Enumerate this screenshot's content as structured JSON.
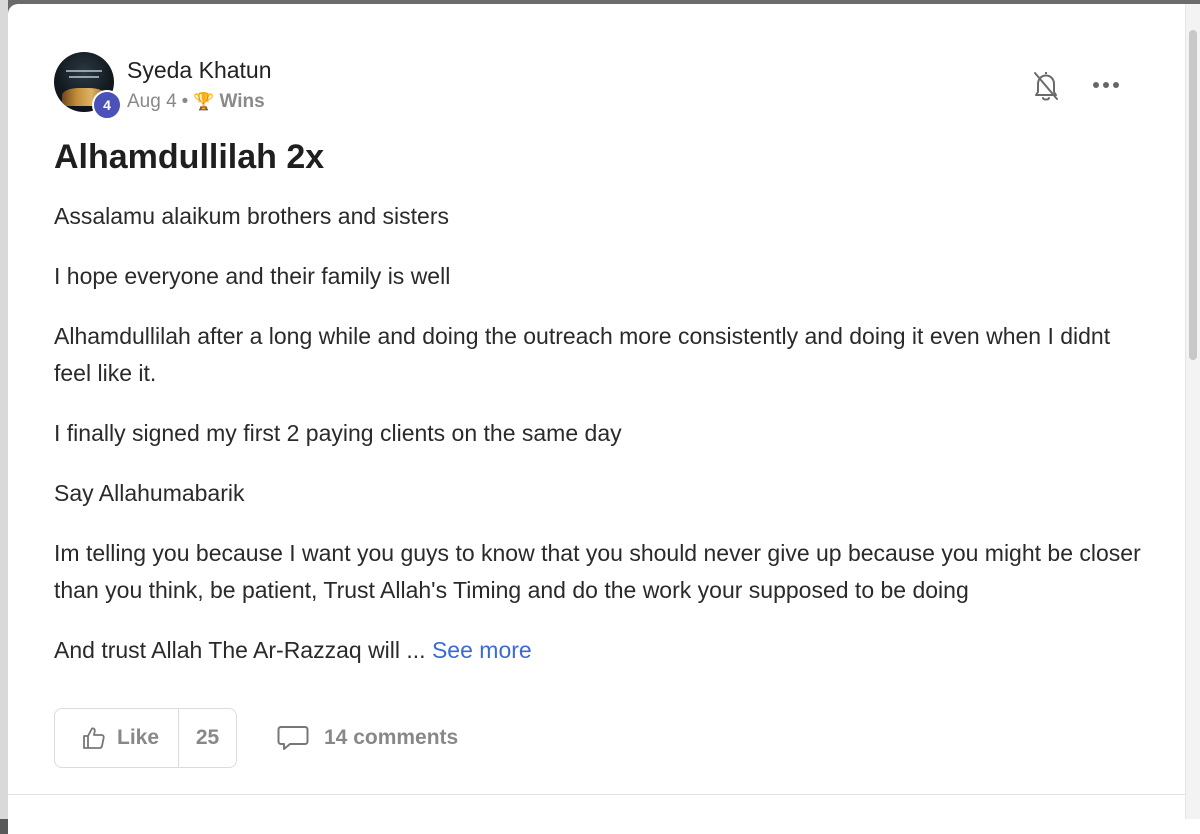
{
  "post": {
    "author": "Syeda Khatun",
    "level": "4",
    "date": "Aug 4",
    "separator": "•",
    "category": "Wins",
    "title": "Alhamdullilah 2x",
    "paragraphs": [
      "Assalamu alaikum brothers and sisters",
      "I hope everyone and their family is well",
      "Alhamdullilah after a long while and doing the outreach more consistently and doing it even when I didnt feel like it.",
      "I finally signed my first 2 paying clients on the same day",
      "Say Allahumabarik",
      "Im telling you because I want you guys to know that you should never give up because you might be closer than you think, be patient, Trust Allah's Timing and do the work your supposed to be doing"
    ],
    "truncated_text": "And trust Allah The Ar-Razzaq will ... ",
    "see_more": "See more"
  },
  "actions": {
    "like_label": "Like",
    "like_count": "25",
    "comments_label": "14 comments"
  },
  "icons": {
    "bell": "bell-off-icon",
    "more": "more-horizontal-icon",
    "like": "thumbs-up-icon",
    "comment": "comment-bubble-icon",
    "trophy": "trophy-icon"
  },
  "colors": {
    "accent_link": "#3b6ad6",
    "level_badge": "#4a52b8",
    "muted_text": "#888888"
  }
}
